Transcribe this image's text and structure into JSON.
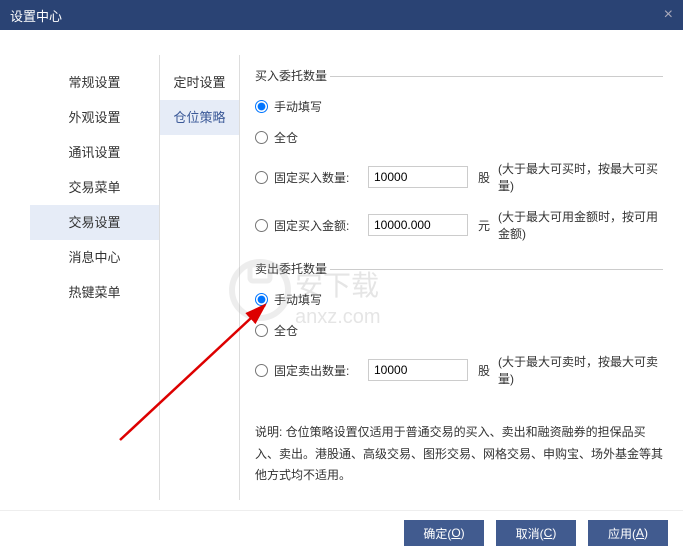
{
  "title": "设置中心",
  "sidebar": {
    "items": [
      {
        "label": "常规设置"
      },
      {
        "label": "外观设置"
      },
      {
        "label": "通讯设置"
      },
      {
        "label": "交易菜单"
      },
      {
        "label": "交易设置"
      },
      {
        "label": "消息中心"
      },
      {
        "label": "热键菜单"
      }
    ]
  },
  "subnav": {
    "items": [
      {
        "label": "定时设置"
      },
      {
        "label": "仓位策略"
      }
    ]
  },
  "buy": {
    "title": "买入委托数量",
    "manual": "手动填写",
    "full": "全仓",
    "fixedQtyLabel": "固定买入数量:",
    "fixedQtyValue": "10000",
    "fixedQtyUnit": "股",
    "fixedQtyHint": "(大于最大可买时，按最大可买量)",
    "fixedAmtLabel": "固定买入金额:",
    "fixedAmtValue": "10000.000",
    "fixedAmtUnit": "元",
    "fixedAmtHint": "(大于最大可用金额时，按可用金额)"
  },
  "sell": {
    "title": "卖出委托数量",
    "manual": "手动填写",
    "full": "全仓",
    "fixedQtyLabel": "固定卖出数量:",
    "fixedQtyValue": "10000",
    "fixedQtyUnit": "股",
    "fixedQtyHint": "(大于最大可卖时，按最大可卖量)"
  },
  "explain": "说明: 仓位策略设置仅适用于普通交易的买入、卖出和融资融券的担保品买入、卖出。港股通、高级交易、图形交易、网格交易、申购宝、场外基金等其他方式均不适用。",
  "buttons": {
    "ok": "确定(",
    "okKey": "O",
    "okEnd": ")",
    "cancel": "取消(",
    "cancelKey": "C",
    "cancelEnd": ")",
    "apply": "应用(",
    "applyKey": "A",
    "applyEnd": ")"
  },
  "watermark": {
    "text1": "安下载",
    "text2": "anxz.com"
  }
}
